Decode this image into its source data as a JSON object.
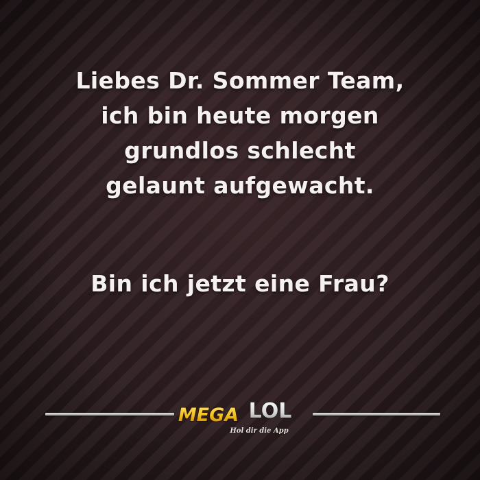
{
  "message": {
    "lines": [
      "Liebes Dr. Sommer Team,",
      "ich bin heute morgen",
      "grundlos schlecht",
      "gelaunt aufgewacht."
    ],
    "question": "Bin ich jetzt eine Frau?"
  },
  "logo": {
    "word_mega": "MEGA",
    "word_lol": "LOL",
    "tagline": "Hol dir die App",
    "colors": {
      "mega": "#f2c21a",
      "lol": "#e9e9e9",
      "background": "#2c1d20"
    }
  }
}
